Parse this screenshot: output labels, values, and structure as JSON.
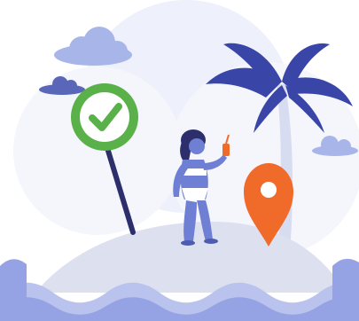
{
  "illustration": {
    "elements": [
      "cloud",
      "check-sign",
      "palm-tree",
      "woman-with-drink",
      "location-pin",
      "island",
      "waves"
    ]
  },
  "colors": {
    "sky_blob": "#eef1fb",
    "cloud": "#a8b5e8",
    "cloud_dark": "#5a67b8",
    "check_ring": "#5ab14a",
    "check_fill": "#ffffff",
    "sign_pole": "#2c2f6b",
    "palm_leaves": "#3a45a8",
    "palm_trunk": "#d8dcf0",
    "island_sand": "#dde0ef",
    "pin": "#f06a2a",
    "woman_skin": "#6f7fd4",
    "woman_hair": "#2c2f6b",
    "waves_light": "#b9c3ee",
    "waves_mid": "#95a3e4"
  }
}
